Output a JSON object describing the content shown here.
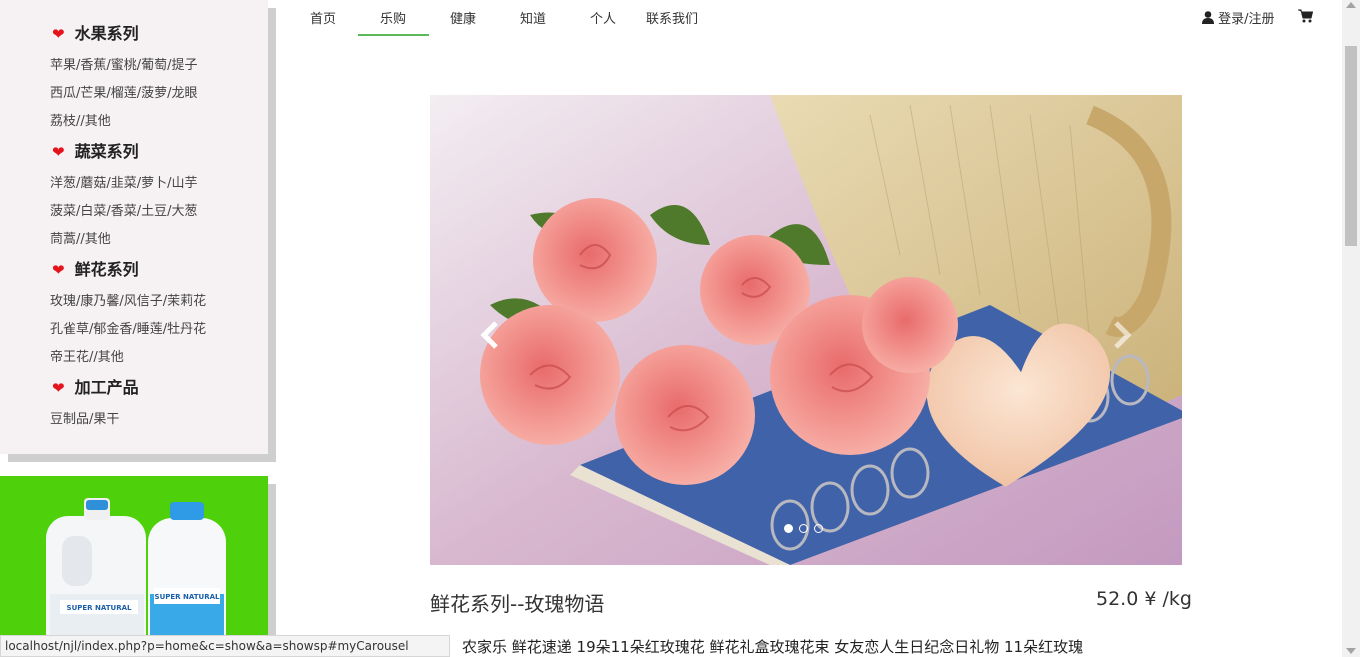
{
  "nav": {
    "items": [
      "首页",
      "乐购",
      "健康",
      "知道",
      "个人",
      "联系我们"
    ],
    "active_index": 1,
    "login_label": "登录/注册"
  },
  "sidebar": {
    "categories": [
      {
        "title": "水果系列",
        "items": [
          "苹果/香蕉/蜜桃/葡萄/提子",
          "西瓜/芒果/榴莲/菠萝/龙眼",
          "荔枝//其他"
        ]
      },
      {
        "title": "蔬菜系列",
        "items": [
          "洋葱/蘑菇/韭菜/萝卜/山芋",
          "菠菜/白菜/香菜/土豆/大葱",
          "茼蒿//其他"
        ]
      },
      {
        "title": "鲜花系列",
        "items": [
          "玫瑰/康乃馨/风信子/茉莉花",
          "孔雀草/郁金香/睡莲/牡丹花",
          "帝王花//其他"
        ]
      },
      {
        "title": "加工产品",
        "items": [
          "豆制品/果干"
        ]
      }
    ]
  },
  "carousel": {
    "slide_count": 3,
    "active_slide": 0
  },
  "product": {
    "title": "鲜花系列--玫瑰物语",
    "price": "52.0 ¥ /kg",
    "description": "农家乐 鲜花速递 19朵11朵红玫瑰花 鲜花礼盒玫瑰花束 女友恋人生日纪念日礼物 11朵红玫瑰"
  },
  "promo": {
    "bottle_label": "SUPER NATURAL"
  },
  "status_url": "localhost/njl/index.php?p=home&c=show&a=showsp#myCarousel",
  "colors": {
    "sidebar_bg": "#f6f1f3",
    "heart": "#e4141b",
    "nav_active": "#5bb85b",
    "promo_bg": "#4ed10a"
  }
}
